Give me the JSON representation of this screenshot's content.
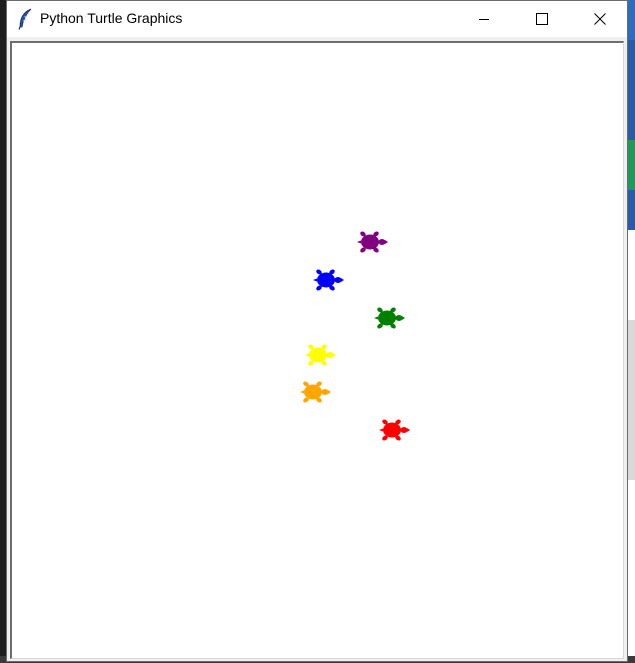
{
  "window": {
    "title": "Python Turtle Graphics",
    "controls": [
      "minimize",
      "maximize",
      "close"
    ]
  },
  "canvas": {
    "background": "#ffffff",
    "turtles": [
      {
        "name": "purple-turtle",
        "color": "#800080",
        "heading": "east"
      },
      {
        "name": "blue-turtle",
        "color": "#0000ff",
        "heading": "east"
      },
      {
        "name": "green-turtle",
        "color": "#008000",
        "heading": "east"
      },
      {
        "name": "yellow-turtle",
        "color": "#ffff00",
        "heading": "east"
      },
      {
        "name": "orange-turtle",
        "color": "#ffa500",
        "heading": "east"
      },
      {
        "name": "red-turtle",
        "color": "#ff0000",
        "heading": "east"
      }
    ]
  },
  "icons": {
    "app": "feather-icon",
    "minimize": "minimize-icon",
    "maximize": "maximize-icon",
    "close": "close-icon"
  }
}
